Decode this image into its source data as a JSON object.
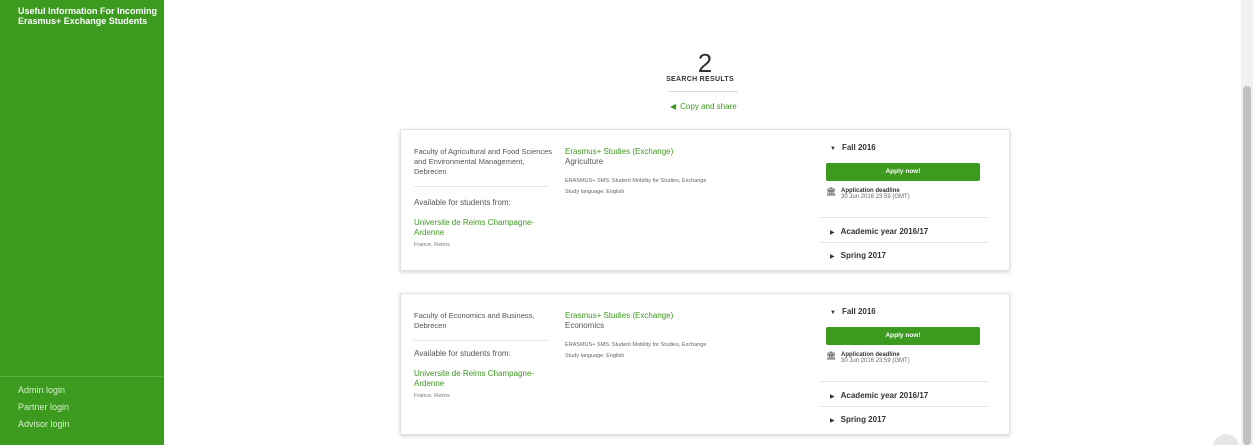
{
  "sidebar": {
    "top_link": "Useful Information For Incoming Erasmus+ Exchange Students",
    "bottom_links": [
      "Admin login",
      "Partner login",
      "Advisor login"
    ]
  },
  "results": {
    "count": "2",
    "label": "SEARCH RESULTS",
    "share_label": "Copy and share"
  },
  "cards": [
    {
      "institution": "Faculty of Agricultural and Food Sciences and Environmental Management, Debrecen",
      "available_label": "Available for students from:",
      "partner": "Universite de Reims Champagne-Ardenne",
      "location": "France, Reims",
      "program": "Erasmus+ Studies (Exchange)",
      "field": "Agriculture",
      "mobility": "ERASMUS+ SMS: Student Mobility for Studies, Exchange",
      "language": "Study language: English",
      "term_open": "Fall 2016",
      "apply_label": "Apply now!",
      "deadline_label": "Application deadline",
      "deadline_date": "30 Jun 2016 23:59 (GMT)",
      "other_terms": [
        "Academic year 2016/17",
        "Spring 2017"
      ]
    },
    {
      "institution": "Faculty of Economics and Business, Debrecen",
      "available_label": "Available for students from:",
      "partner": "Universite de Reims Champagne-Ardenne",
      "location": "France, Reims",
      "program": "Erasmus+ Studies (Exchange)",
      "field": "Economics",
      "mobility": "ERASMUS+ SMS: Student Mobility for Studies, Exchange",
      "language": "Study language: English",
      "term_open": "Fall 2016",
      "apply_label": "Apply now!",
      "deadline_label": "Application deadline",
      "deadline_date": "30 Jun 2016 23:59 (GMT)",
      "other_terms": [
        "Academic year 2016/17",
        "Spring 2017"
      ]
    }
  ],
  "icons": {
    "share": "share-icon",
    "deadline": "institution-icon",
    "expanded": "caret-down-icon",
    "collapsed": "caret-right-icon"
  },
  "colors": {
    "brand_green": "#3c9a1f"
  }
}
